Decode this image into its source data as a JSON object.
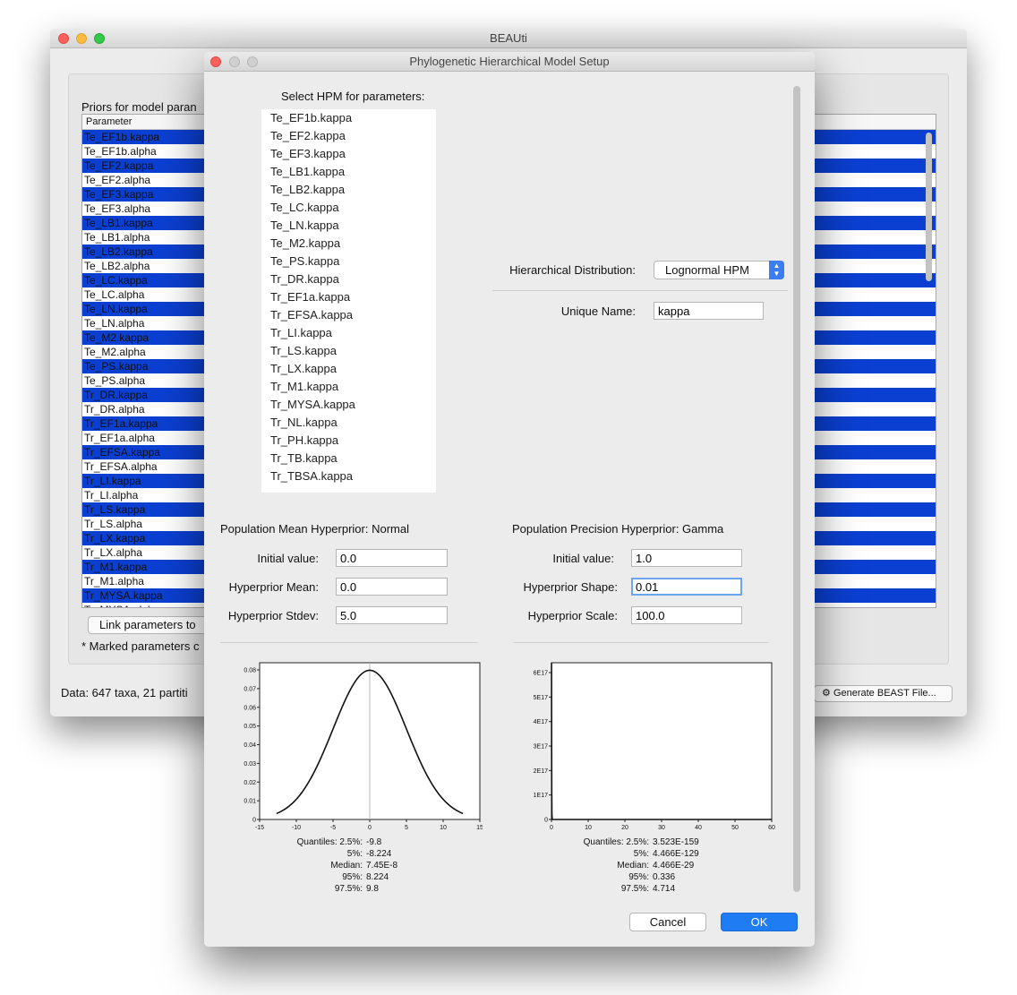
{
  "main_window": {
    "title": "BEAUti",
    "priors_heading": "Priors for model paran",
    "param_column_header": "Parameter",
    "params": [
      {
        "name": "Te_EF1b.kappa",
        "selected": true
      },
      {
        "name": "Te_EF1b.alpha",
        "selected": false
      },
      {
        "name": "Te_EF2.kappa",
        "selected": true
      },
      {
        "name": "Te_EF2.alpha",
        "selected": false
      },
      {
        "name": "Te_EF3.kappa",
        "selected": true
      },
      {
        "name": "Te_EF3.alpha",
        "selected": false
      },
      {
        "name": "Te_LB1.kappa",
        "selected": true
      },
      {
        "name": "Te_LB1.alpha",
        "selected": false
      },
      {
        "name": "Te_LB2.kappa",
        "selected": true
      },
      {
        "name": "Te_LB2.alpha",
        "selected": false
      },
      {
        "name": "Te_LC.kappa",
        "selected": true
      },
      {
        "name": "Te_LC.alpha",
        "selected": false
      },
      {
        "name": "Te_LN.kappa",
        "selected": true
      },
      {
        "name": "Te_LN.alpha",
        "selected": false
      },
      {
        "name": "Te_M2.kappa",
        "selected": true
      },
      {
        "name": "Te_M2.alpha",
        "selected": false
      },
      {
        "name": "Te_PS.kappa",
        "selected": true
      },
      {
        "name": "Te_PS.alpha",
        "selected": false
      },
      {
        "name": "Tr_DR.kappa",
        "selected": true
      },
      {
        "name": "Tr_DR.alpha",
        "selected": false
      },
      {
        "name": "Tr_EF1a.kappa",
        "selected": true
      },
      {
        "name": "Tr_EF1a.alpha",
        "selected": false
      },
      {
        "name": "Tr_EFSA.kappa",
        "selected": true
      },
      {
        "name": "Tr_EFSA.alpha",
        "selected": false
      },
      {
        "name": "Tr_LI.kappa",
        "selected": true
      },
      {
        "name": "Tr_LI.alpha",
        "selected": false
      },
      {
        "name": "Tr_LS.kappa",
        "selected": true
      },
      {
        "name": "Tr_LS.alpha",
        "selected": false
      },
      {
        "name": "Tr_LX.kappa",
        "selected": true
      },
      {
        "name": "Tr_LX.alpha",
        "selected": false
      },
      {
        "name": "Tr_M1.kappa",
        "selected": true
      },
      {
        "name": "Tr_M1.alpha",
        "selected": false
      },
      {
        "name": "Tr_MYSA.kappa",
        "selected": true
      },
      {
        "name": "Tr_MYSA.alpha",
        "selected": false
      }
    ],
    "link_button": "Link parameters to",
    "marked_note": "* Marked parameters c",
    "data_status": "Data: 647 taxa, 21 partiti",
    "generate_button": "Generate BEAST File...",
    "gear_icon": "gear-icon"
  },
  "dialog": {
    "title": "Phylogenetic Hierarchical Model Setup",
    "select_label": "Select HPM for parameters:",
    "hpm_params": [
      "Te_EF1b.kappa",
      "Te_EF2.kappa",
      "Te_EF3.kappa",
      "Te_LB1.kappa",
      "Te_LB2.kappa",
      "Te_LC.kappa",
      "Te_LN.kappa",
      "Te_M2.kappa",
      "Te_PS.kappa",
      "Tr_DR.kappa",
      "Tr_EF1a.kappa",
      "Tr_EFSA.kappa",
      "Tr_LI.kappa",
      "Tr_LS.kappa",
      "Tr_LX.kappa",
      "Tr_M1.kappa",
      "Tr_MYSA.kappa",
      "Tr_NL.kappa",
      "Tr_PH.kappa",
      "Tr_TB.kappa",
      "Tr_TBSA.kappa"
    ],
    "hier_dist_label": "Hierarchical Distribution:",
    "hier_dist_value": "Lognormal HPM",
    "unique_name_label": "Unique Name:",
    "unique_name_value": "kappa",
    "mean": {
      "title": "Population Mean Hyperprior: Normal",
      "initial_label": "Initial value:",
      "initial_value": "0.0",
      "p1_label": "Hyperprior Mean:",
      "p1_value": "0.0",
      "p2_label": "Hyperprior Stdev:",
      "p2_value": "5.0",
      "quantiles": {
        "title": "Quantiles: 2.5%:",
        "q2_5": "-9.8",
        "q5_label": "5%:",
        "q5": "-8.224",
        "median_label": "Median:",
        "median": "7.45E-8",
        "q95_label": "95%:",
        "q95": "8.224",
        "q97_5_label": "97.5%:",
        "q97_5": "9.8"
      }
    },
    "precision": {
      "title": "Population Precision Hyperprior: Gamma",
      "initial_label": "Initial value:",
      "initial_value": "1.0",
      "p1_label": "Hyperprior Shape:",
      "p1_value": "0.01",
      "p2_label": "Hyperprior Scale:",
      "p2_value": "100.0",
      "quantiles": {
        "title": "Quantiles: 2.5%:",
        "q2_5": "3.523E-159",
        "q5_label": "5%:",
        "q5": "4.466E-129",
        "median_label": "Median:",
        "median": "4.466E-29",
        "q95_label": "95%:",
        "q95": "0.336",
        "q97_5_label": "97.5%:",
        "q97_5": "4.714"
      }
    },
    "cancel_button": "Cancel",
    "ok_button": "OK",
    "accent_color": "#1f7cf3",
    "selection_color": "#0b3fd1"
  },
  "chart_data": [
    {
      "type": "line",
      "distribution": "normal",
      "mean": 0.0,
      "stdev": 5.0,
      "x_range": [
        -15,
        15
      ],
      "y_range": [
        0,
        0.08
      ],
      "x_ticks": [
        "-15",
        "-10",
        "-5",
        "0",
        "5",
        "10",
        "15"
      ],
      "y_ticks": [
        "0",
        "0.01",
        "0.02",
        "0.03",
        "0.04",
        "0.05",
        "0.06",
        "0.07",
        "0.08"
      ]
    },
    {
      "type": "line",
      "distribution": "gamma",
      "shape": 0.01,
      "scale": 100.0,
      "x_range": [
        0,
        60
      ],
      "y_range": [
        0,
        6.5e+17
      ],
      "x_ticks": [
        "0",
        "10",
        "20",
        "30",
        "40",
        "50",
        "60"
      ],
      "y_ticks": [
        "0",
        "1E17",
        "2E17",
        "3E17",
        "4E17",
        "5E17",
        "6E17"
      ]
    }
  ]
}
